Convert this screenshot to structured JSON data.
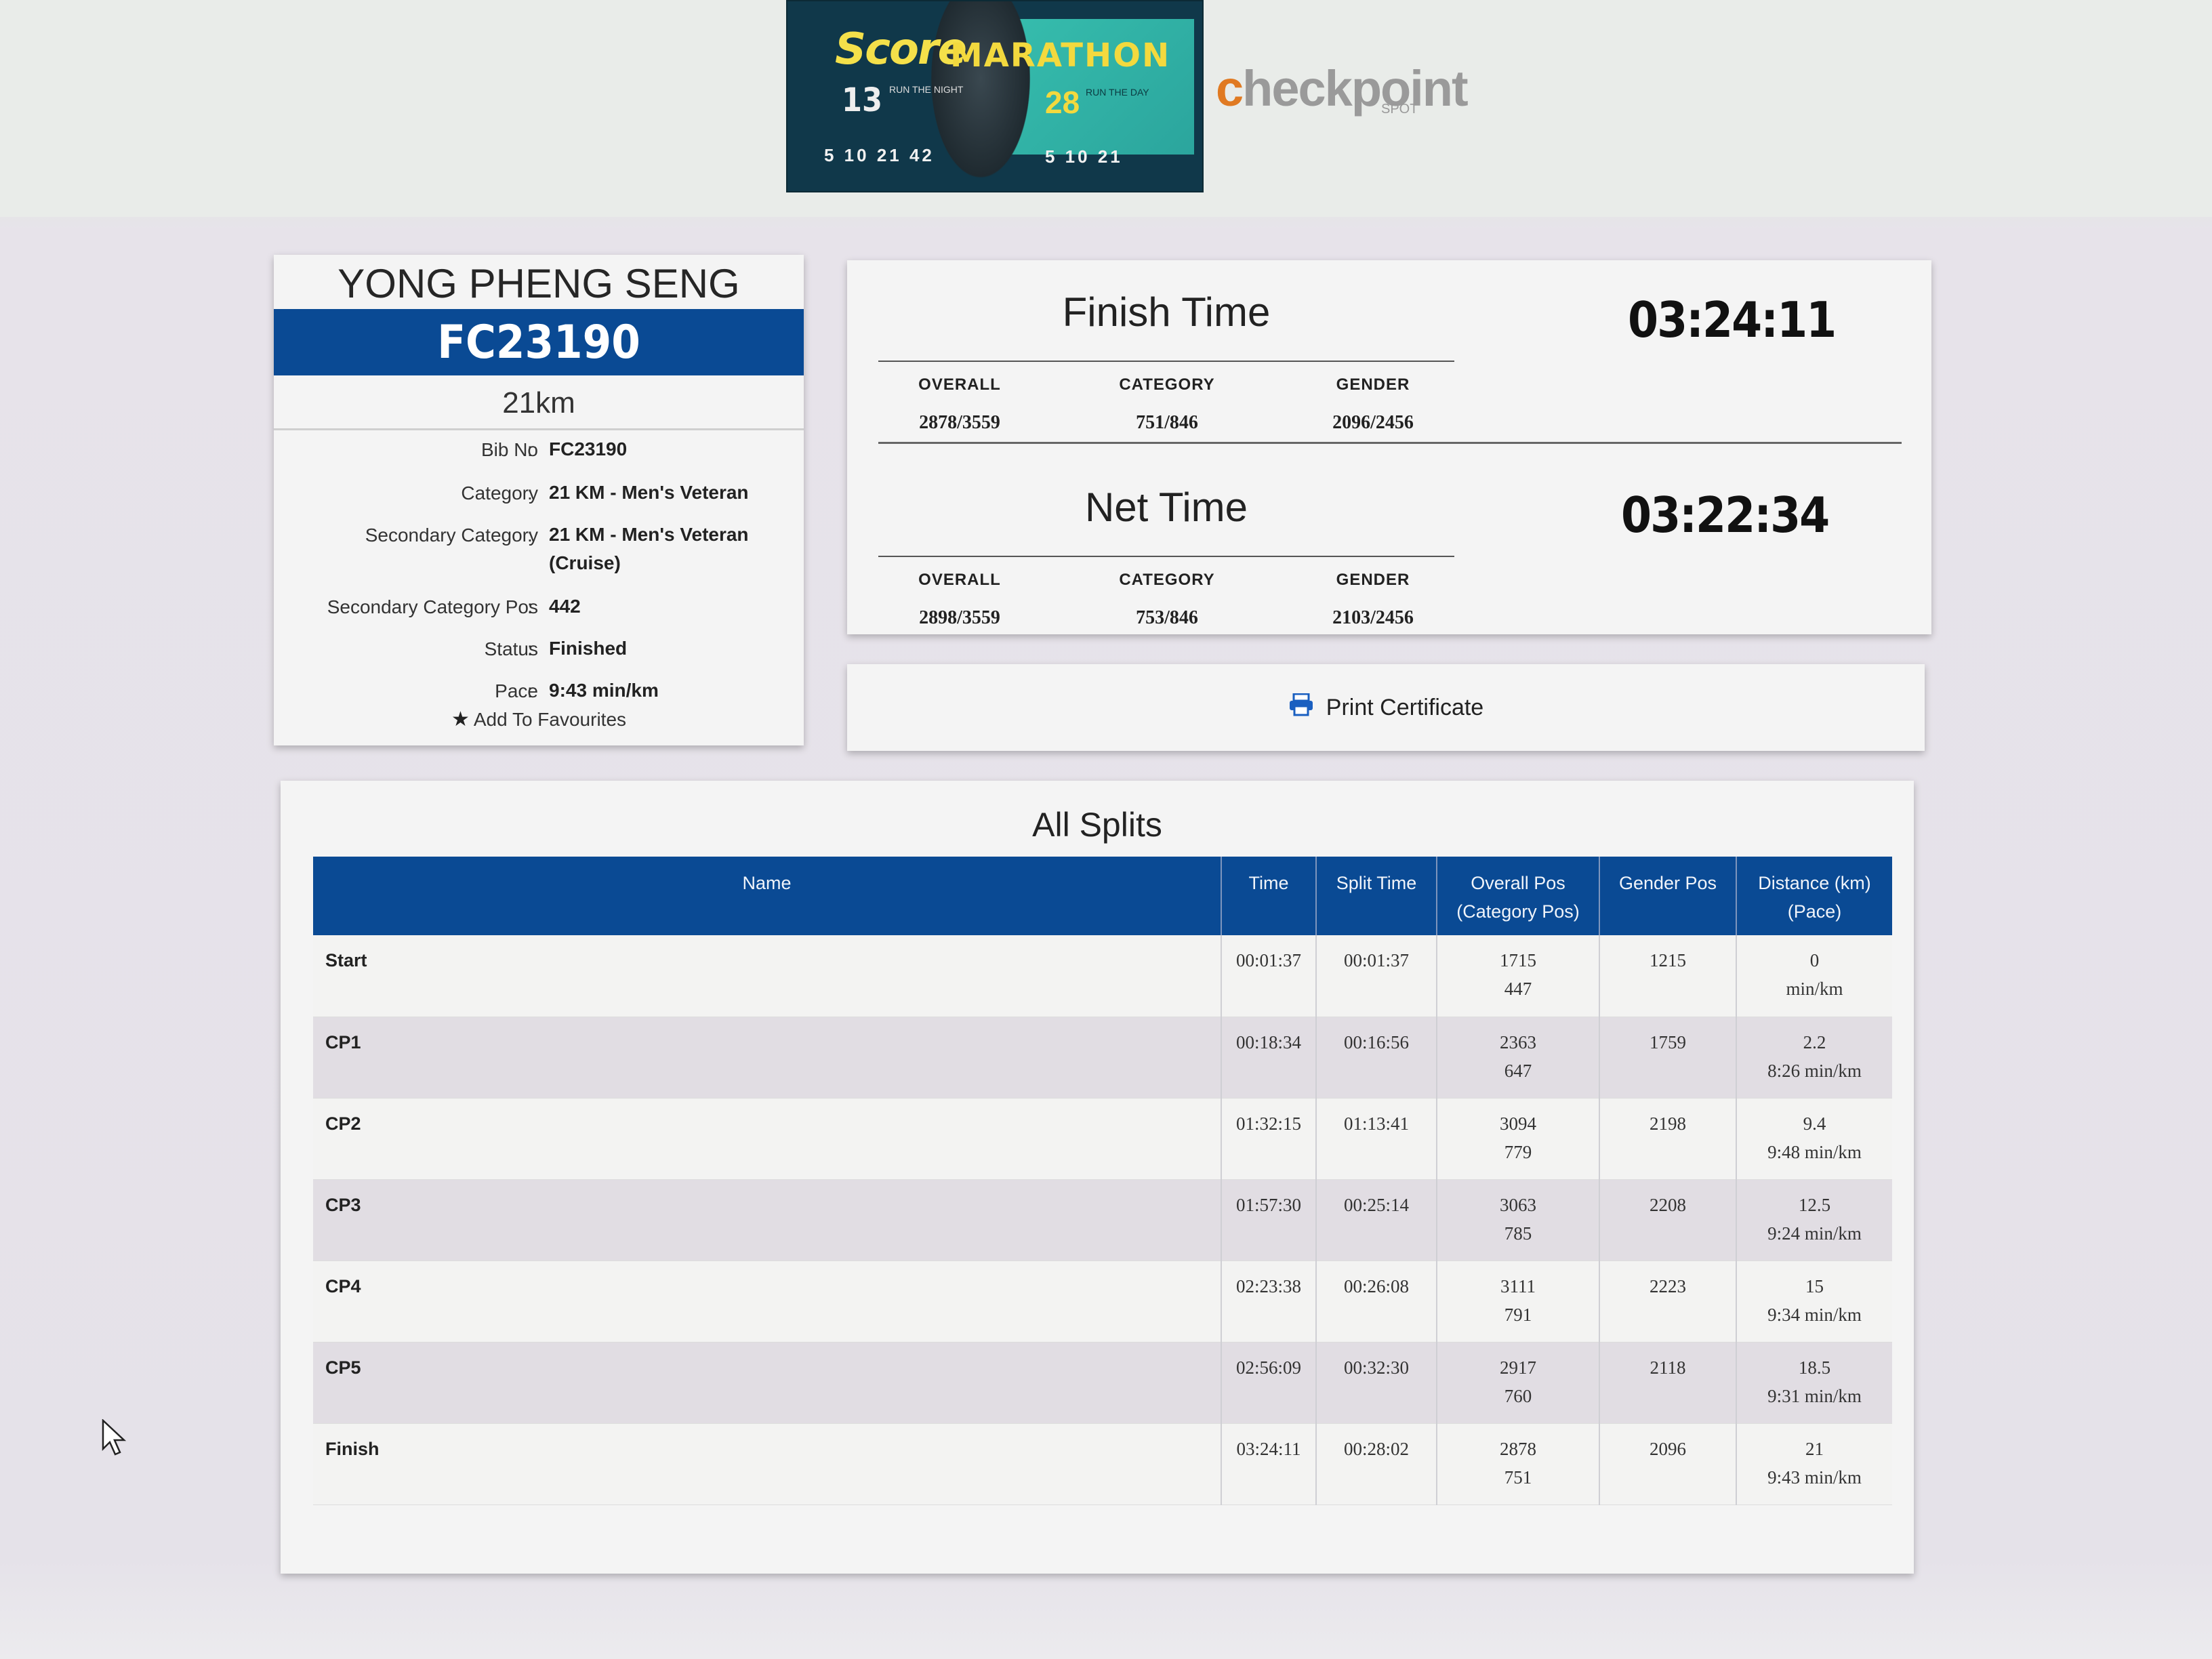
{
  "banner": {
    "score": "Score",
    "marathon": "MARATHON",
    "day1": "13",
    "day1_text": "RUN THE NIGHT",
    "day2": "28",
    "day2_text": "RUN THE DAY",
    "dist1": "5 10 21 42",
    "dist2": "5 10 21"
  },
  "logo": {
    "main_pre": "c",
    "main_o": "",
    "main_rest": "heckpoint",
    "sub": "SPOT"
  },
  "profile": {
    "name": "YONG PHENG SENG",
    "bib_header": "FC23190",
    "distance": "21km",
    "fields": [
      {
        "label": "Bib No",
        "value": "FC23190"
      },
      {
        "label": "Category",
        "value": "21 KM - Men's Veteran"
      },
      {
        "label": "Secondary Category",
        "value": "21 KM - Men's Veteran (Cruise)"
      },
      {
        "label": "Secondary Category Pos",
        "value": "442"
      },
      {
        "label": "Status",
        "value": "Finished"
      },
      {
        "label": "Pace",
        "value": "9:43 min/km"
      }
    ],
    "favourite_label": "Add To Favourites"
  },
  "finish": {
    "title": "Finish Time",
    "time": "03:24:11",
    "overall_label": "OVERALL",
    "overall": "2878/3559",
    "category_label": "CATEGORY",
    "category": "751/846",
    "gender_label": "GENDER",
    "gender": "2096/2456"
  },
  "net": {
    "title": "Net Time",
    "time": "03:22:34",
    "overall_label": "OVERALL",
    "overall": "2898/3559",
    "category_label": "CATEGORY",
    "category": "753/846",
    "gender_label": "GENDER",
    "gender": "2103/2456"
  },
  "print_label": "Print Certificate",
  "splits": {
    "title": "All Splits",
    "columns": {
      "name": "Name",
      "time": "Time",
      "split": "Split Time",
      "overall_a": "Overall Pos",
      "overall_b": "(Category Pos)",
      "gender": "Gender Pos",
      "dist_a": "Distance (km)",
      "dist_b": "(Pace)"
    },
    "rows": [
      {
        "name": "Start",
        "time": "00:01:37",
        "split": "00:01:37",
        "overall": "1715",
        "cat": "447",
        "gender": "1215",
        "dist": "0",
        "pace": "min/km"
      },
      {
        "name": "CP1",
        "time": "00:18:34",
        "split": "00:16:56",
        "overall": "2363",
        "cat": "647",
        "gender": "1759",
        "dist": "2.2",
        "pace": "8:26 min/km"
      },
      {
        "name": "CP2",
        "time": "01:32:15",
        "split": "01:13:41",
        "overall": "3094",
        "cat": "779",
        "gender": "2198",
        "dist": "9.4",
        "pace": "9:48 min/km"
      },
      {
        "name": "CP3",
        "time": "01:57:30",
        "split": "00:25:14",
        "overall": "3063",
        "cat": "785",
        "gender": "2208",
        "dist": "12.5",
        "pace": "9:24 min/km"
      },
      {
        "name": "CP4",
        "time": "02:23:38",
        "split": "00:26:08",
        "overall": "3111",
        "cat": "791",
        "gender": "2223",
        "dist": "15",
        "pace": "9:34 min/km"
      },
      {
        "name": "CP5",
        "time": "02:56:09",
        "split": "00:32:30",
        "overall": "2917",
        "cat": "760",
        "gender": "2118",
        "dist": "18.5",
        "pace": "9:31 min/km"
      },
      {
        "name": "Finish",
        "time": "03:24:11",
        "split": "00:28:02",
        "overall": "2878",
        "cat": "751",
        "gender": "2096",
        "dist": "21",
        "pace": "9:43 min/km"
      }
    ]
  },
  "icons": {
    "print": "printer-icon",
    "favourite": "star-icon",
    "cursor": "mouse-pointer-icon"
  },
  "colors": {
    "brand_blue": "#0a4a94",
    "logo_orange": "#e07a22"
  }
}
